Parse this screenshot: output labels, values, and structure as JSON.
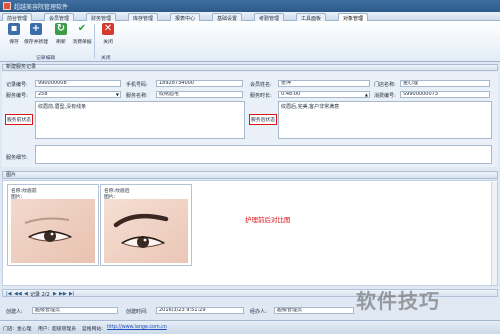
{
  "window": {
    "title": "超越美容院管理软件"
  },
  "menu": {
    "items": [
      {
        "label": "前台管理"
      },
      {
        "label": "会员管理"
      },
      {
        "label": "财务管理"
      },
      {
        "label": "库存管理"
      },
      {
        "label": "报表中心"
      },
      {
        "label": "基础设置"
      },
      {
        "label": "考勤管理"
      },
      {
        "label": "工具面板"
      },
      {
        "label": "对象管理"
      }
    ]
  },
  "ribbon": {
    "buttons": [
      {
        "label": "保存",
        "icon": "save-icon"
      },
      {
        "label": "保存并新建",
        "icon": "save-new-icon"
      },
      {
        "label": "刷新",
        "icon": "refresh-icon"
      },
      {
        "label": "消费单据",
        "icon": "check-icon"
      },
      {
        "label": "关闭",
        "icon": "close-icon"
      }
    ],
    "group_labels": [
      "记录编辑",
      "关闭"
    ]
  },
  "section": {
    "title": "新建服务记录"
  },
  "form": {
    "record_no_label": "记录编号:",
    "record_no": "990000008",
    "phone_label": "手机号码:",
    "phone": "18928734000",
    "member_label": "会员姓名:",
    "member": "张萍",
    "store_label": "门店名称:",
    "store": "金心理",
    "project_no_label": "服务编号:",
    "project_no": "258",
    "service_name_label": "服务名称:",
    "service_name": "纹绣眉毛",
    "service_time_label": "服务时长:",
    "service_time": "0:48:00",
    "consume_no_label": "消费编号:",
    "consume_no": "S9900000073",
    "before_label": "服务前状态",
    "before_text": "纹眉前,眉型,没有线条",
    "after_label": "服务后状态",
    "after_text": "纹眉后,完美,客户非常满意",
    "remark_label": "服务细节:"
  },
  "photos": {
    "title": "图片",
    "before": {
      "name_label": "名称:",
      "name": "纹眉前",
      "img_label": "图片:"
    },
    "after": {
      "name_label": "名称:",
      "name": "纹眉后",
      "img_label": "图片:"
    },
    "compare_text": "护理前后对比图"
  },
  "nav": {
    "record_text": "记录 2/2"
  },
  "footer": {
    "creator_label": "创建人:",
    "creator": "超级管理员",
    "create_time_label": "创建时间:",
    "create_time": "2016/3/23 9:51:29",
    "operator_label": "经办人:",
    "operator": "超级管理员"
  },
  "status": {
    "store_label": "门店:",
    "store": "金心理",
    "user_label": "用户:",
    "user": "超级管理员",
    "site_label": "蓝格网站:",
    "site": "http://www.lange.com.cn"
  },
  "watermark": "软件技巧",
  "colors": {
    "accent": "#2d5a89",
    "highlight_red": "#d9141a"
  }
}
